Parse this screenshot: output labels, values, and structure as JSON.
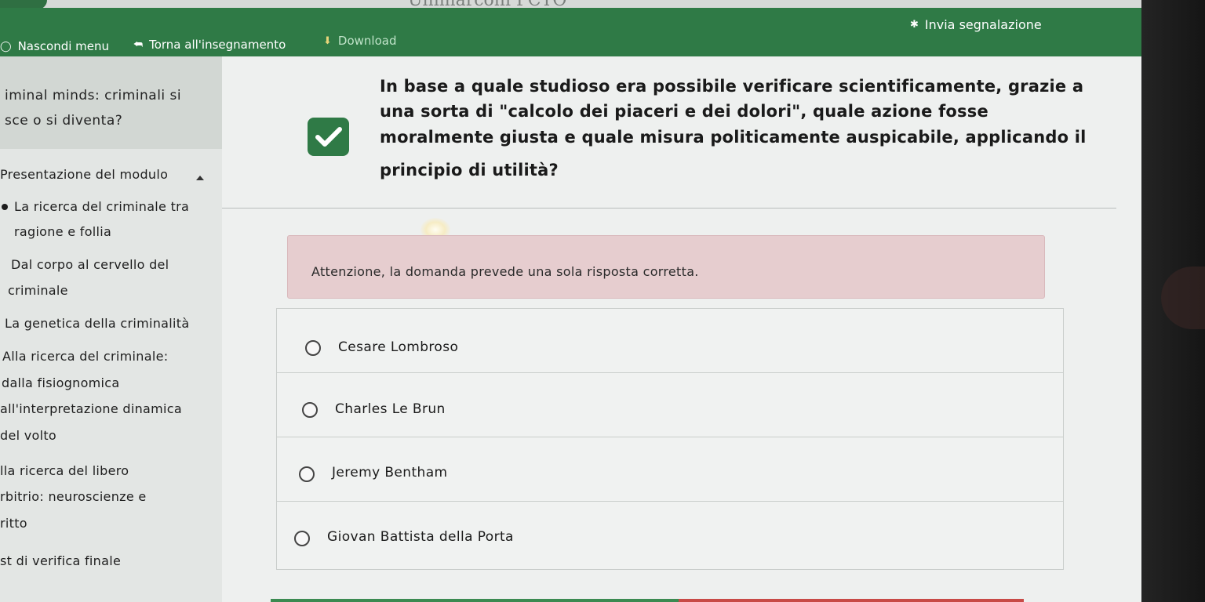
{
  "header": {
    "logo_partial_text": "Unimarconi PCTO"
  },
  "navbar": {
    "hide_menu": "Nascondi menu",
    "back_to_course": "Torna all'insegnamento",
    "download": "Download",
    "report": "Invia segnalazione"
  },
  "sidebar": {
    "module_title_line1": "iminal minds: criminali si",
    "module_title_line2": "sce o si diventa?",
    "section_label": "Presentazione del modulo",
    "items": [
      {
        "line1": "La ricerca del criminale tra",
        "line2": "ragione e follia"
      },
      {
        "line1": "Dal corpo al cervello del",
        "line2": "criminale"
      },
      {
        "line1": "La genetica della criminalità",
        "line2": ""
      },
      {
        "line1": "Alla ricerca del criminale:",
        "line2": "dalla fisiognomica"
      },
      {
        "line1": "all'interpretazione dinamica",
        "line2": "del volto"
      },
      {
        "line1": "lla ricerca del libero",
        "line2": "rbitrio: neuroscienze e"
      },
      {
        "line1": "ritto",
        "line2": ""
      },
      {
        "line1": "st di verifica finale",
        "line2": ""
      }
    ]
  },
  "question": {
    "lines": [
      "In base a quale studioso era possibile verificare scientificamente, grazie a",
      "una sorta di \"calcolo dei piaceri e dei dolori\", quale azione fosse",
      "moralmente giusta e quale misura politicamente auspicabile, applicando il",
      "principio di utilità?"
    ],
    "notice": "Attenzione, la domanda prevede una sola risposta corretta."
  },
  "answers": [
    {
      "label": "Cesare Lombroso"
    },
    {
      "label": "Charles Le Brun"
    },
    {
      "label": "Jeremy Bentham"
    },
    {
      "label": "Giovan Battista della Porta"
    }
  ],
  "colors": {
    "brand_green": "#2f7a46",
    "notice_bg": "#e6cdcf",
    "progress_green": "#3b8a51",
    "progress_red": "#c84a46"
  },
  "icons": {
    "hide_menu": "circle-icon",
    "back": "reply-arrow-icon",
    "download": "download-icon",
    "report": "bug-icon",
    "completed": "checkmark-icon",
    "collapse": "caret-up-icon"
  }
}
